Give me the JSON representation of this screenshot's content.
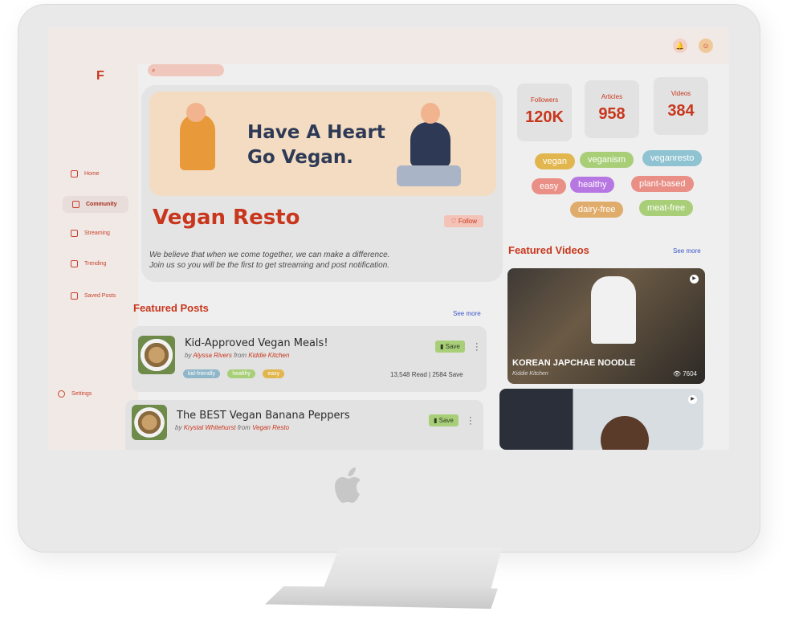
{
  "app": {
    "logo": "F"
  },
  "sidebar": {
    "items": [
      {
        "label": "Home",
        "icon": "home-icon"
      },
      {
        "label": "Community",
        "icon": "community-icon"
      },
      {
        "label": "Streaming",
        "icon": "streaming-icon"
      },
      {
        "label": "Trending",
        "icon": "flag-icon"
      },
      {
        "label": "Saved Posts",
        "icon": "bookmark-icon"
      },
      {
        "label": "Settings",
        "icon": "gear-icon"
      }
    ]
  },
  "search": {
    "placeholder": ""
  },
  "header": {
    "icons": [
      "bell-icon",
      "avatar"
    ]
  },
  "hero": {
    "banner_line1": "Have A Heart",
    "banner_line2": "Go Vegan.",
    "title": "Vegan Resto",
    "follow_label": "♡ Follow",
    "description_line1": "We believe that when we come together, we can make a difference.",
    "description_line2": "Join us so you will be the first to get streaming and post notification."
  },
  "featured_posts": {
    "heading": "Featured Posts",
    "see_more": "See more",
    "posts": [
      {
        "title": "Kid-Approved Vegan Meals!",
        "by": "by",
        "author": "Alyssa Rivers",
        "from": "from",
        "source": "Kiddie Kitchen",
        "tags": [
          "kid-friendly",
          "healthy",
          "easy"
        ],
        "save_label": "Save",
        "stats": "13,548 Read  |  2584 Save"
      },
      {
        "title": "The BEST Vegan Banana Peppers",
        "by": "by",
        "author": "Krystal Whitehurst",
        "from": "from",
        "source": "Vegan Resto",
        "save_label": "Save"
      }
    ]
  },
  "stats": [
    {
      "label": "Followers",
      "value": "120K"
    },
    {
      "label": "Articles",
      "value": "958"
    },
    {
      "label": "Videos",
      "value": "384"
    }
  ],
  "chips": [
    "vegan",
    "veganism",
    "veganresto",
    "easy",
    "healthy",
    "plant-based",
    "dairy-free",
    "meat-free"
  ],
  "featured_videos": {
    "heading": "Featured Videos",
    "see_more": "See more",
    "videos": [
      {
        "title": "KOREAN JAPCHAE NOODLE",
        "channel": "Kiddie Kitchen",
        "views": "👁 7604"
      }
    ]
  },
  "colors": {
    "accent": "#c8361c",
    "link": "#3b56c9"
  }
}
